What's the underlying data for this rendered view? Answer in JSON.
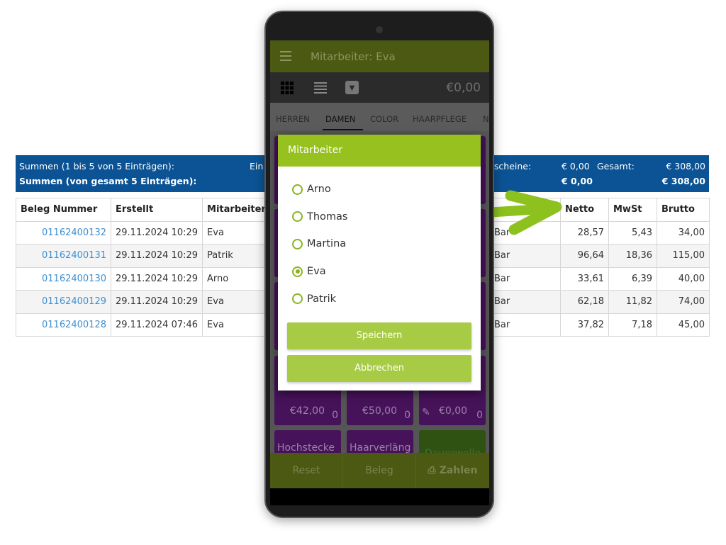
{
  "summary": {
    "row1_label": "Summen (1 bis 5 von 5 Einträgen):",
    "row2_label": "Summen (von gesamt 5 Einträgen):",
    "partial_label": "Ein",
    "gutscheine_label": "tscheine:",
    "gutscheine_page": "€ 0,00",
    "gutscheine_total": "€ 0,00",
    "gesamt_label": "Gesamt:",
    "gesamt_page": "€ 308,00",
    "gesamt_total": "€ 308,00"
  },
  "table": {
    "columns_left": [
      "Beleg Nummer",
      "Erstellt",
      "Mitarbeiter"
    ],
    "columns_right": [
      "Netto",
      "MwSt",
      "Brutto"
    ],
    "rows": [
      {
        "nr": "01162400132",
        "created": "29.11.2024 10:29",
        "employee": "Eva",
        "pay": "Bar",
        "netto": "28,57",
        "mwst": "5,43",
        "brutto": "34,00"
      },
      {
        "nr": "01162400131",
        "created": "29.11.2024 10:29",
        "employee": "Patrik",
        "pay": "Bar",
        "netto": "96,64",
        "mwst": "18,36",
        "brutto": "115,00"
      },
      {
        "nr": "01162400130",
        "created": "29.11.2024 10:29",
        "employee": "Arno",
        "pay": "Bar",
        "netto": "33,61",
        "mwst": "6,39",
        "brutto": "40,00"
      },
      {
        "nr": "01162400129",
        "created": "29.11.2024 10:29",
        "employee": "Eva",
        "pay": "Bar",
        "netto": "62,18",
        "mwst": "11,82",
        "brutto": "74,00"
      },
      {
        "nr": "01162400128",
        "created": "29.11.2024 07:46",
        "employee": "Eva",
        "pay": "Bar",
        "netto": "37,82",
        "mwst": "7,18",
        "brutto": "45,00"
      }
    ]
  },
  "app": {
    "title": "Mitarbeiter: Eva",
    "total": "€0,00",
    "tabs": [
      "HERREN",
      "DAMEN",
      "COLOR",
      "HAARPFLEGE",
      "N"
    ],
    "active_tab": "DAMEN",
    "tiles": {
      "price1": "€42,00",
      "price2": "€50,00",
      "price3": "€0,00",
      "count": "0",
      "name1": "Hochstecke",
      "name2": "Haarverläng",
      "name3": "Dauerwelle"
    },
    "bottom": {
      "reset": "Reset",
      "beleg": "Beleg",
      "zahlen": "Zahlen"
    }
  },
  "dialog": {
    "title": "Mitarbeiter",
    "options": [
      "Arno",
      "Thomas",
      "Martina",
      "Eva",
      "Patrik"
    ],
    "selected": "Eva",
    "save": "Speichern",
    "cancel": "Abbrechen"
  },
  "colors": {
    "accent": "#96c11f",
    "header_blue": "#0b5394",
    "tile_purple": "#46125a",
    "arrow": "#8cc11e"
  }
}
